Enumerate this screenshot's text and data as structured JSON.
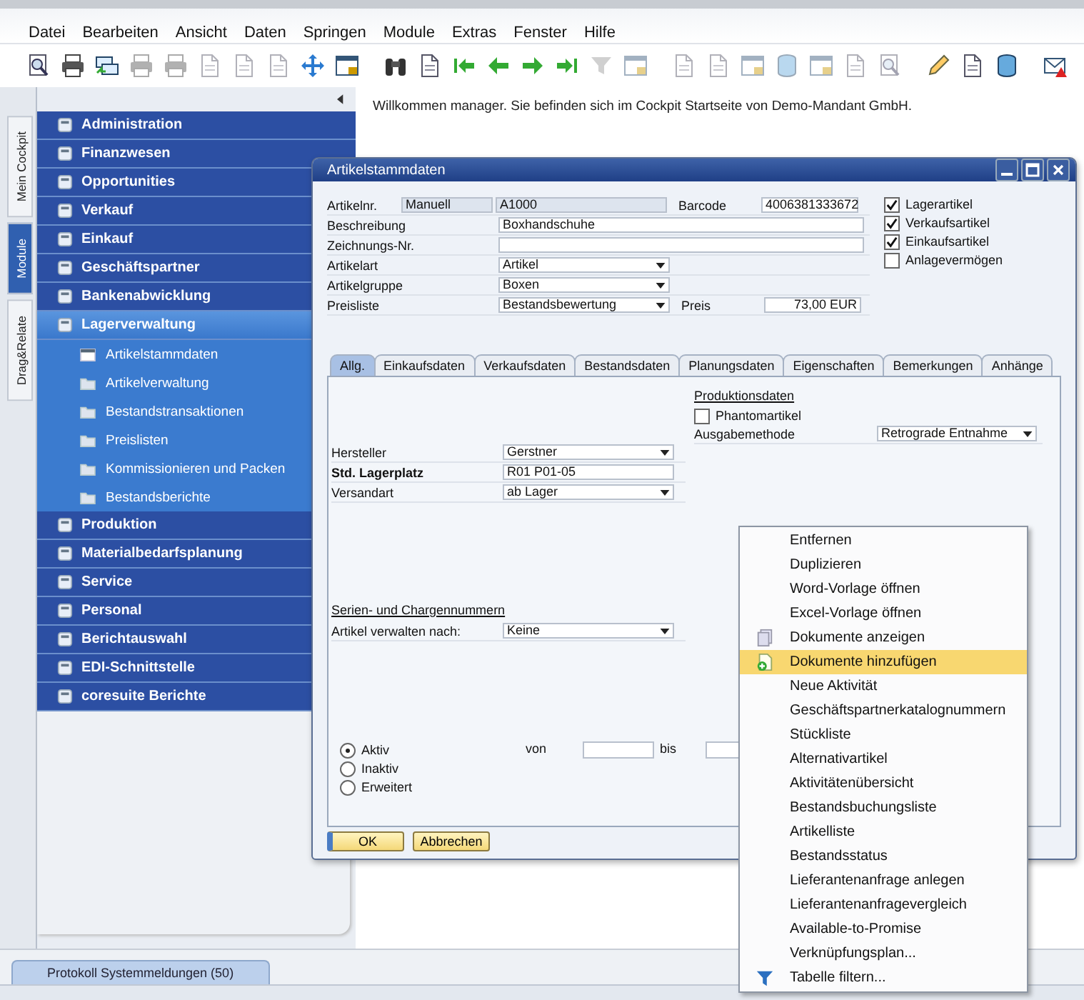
{
  "menu_bar": [
    "Datei",
    "Bearbeiten",
    "Ansicht",
    "Daten",
    "Springen",
    "Module",
    "Extras",
    "Fenster",
    "Hilfe"
  ],
  "side_tabs": [
    {
      "label": "Mein Cockpit",
      "selected": false
    },
    {
      "label": "Module",
      "selected": true
    },
    {
      "label": "Drag&Relate",
      "selected": false
    }
  ],
  "modules": [
    {
      "label": "Administration",
      "selected": false
    },
    {
      "label": "Finanzwesen",
      "selected": false
    },
    {
      "label": "Opportunities",
      "selected": false
    },
    {
      "label": "Verkauf",
      "selected": false
    },
    {
      "label": "Einkauf",
      "selected": false
    },
    {
      "label": "Geschäftspartner",
      "selected": false
    },
    {
      "label": "Bankenabwicklung",
      "selected": false
    },
    {
      "label": "Lagerverwaltung",
      "selected": true,
      "expanded": true,
      "children": [
        {
          "label": "Artikelstammdaten",
          "kind": "window"
        },
        {
          "label": "Artikelverwaltung",
          "kind": "folder"
        },
        {
          "label": "Bestandstransaktionen",
          "kind": "folder"
        },
        {
          "label": "Preislisten",
          "kind": "folder"
        },
        {
          "label": "Kommissionieren und Packen",
          "kind": "folder"
        },
        {
          "label": "Bestandsberichte",
          "kind": "folder"
        }
      ]
    },
    {
      "label": "Produktion",
      "selected": false
    },
    {
      "label": "Materialbedarfsplanung",
      "selected": false
    },
    {
      "label": "Service",
      "selected": false
    },
    {
      "label": "Personal",
      "selected": false
    },
    {
      "label": "Berichtauswahl",
      "selected": false
    },
    {
      "label": "EDI-Schnittstelle",
      "selected": false
    },
    {
      "label": "coresuite Berichte",
      "selected": false
    }
  ],
  "welcome": "Willkommen manager. Sie befinden sich im Cockpit Startseite von Demo-Mandant GmbH.",
  "dialog": {
    "title": "Artikelstammdaten",
    "item_no": {
      "label": "Artikelnr.",
      "mode": "Manuell",
      "value": "A1000"
    },
    "barcode": {
      "label": "Barcode",
      "value": "4006381333672"
    },
    "rows": [
      {
        "label": "Beschreibung",
        "value": "Boxhandschuhe",
        "kind": "text"
      },
      {
        "label": "Zeichnungs-Nr.",
        "kind": "text"
      },
      {
        "label": "Artikelart",
        "value": "Artikel",
        "kind": "dropdown"
      },
      {
        "label": "Artikelgruppe",
        "value": "Boxen",
        "kind": "dropdown"
      },
      {
        "label": "Preisliste",
        "value": "Bestandsbewertung",
        "kind": "dropdown",
        "price": {
          "label": "Preis",
          "value": "73,00 EUR"
        }
      }
    ],
    "flags": [
      {
        "label": "Lagerartikel",
        "checked": true
      },
      {
        "label": "Verkaufsartikel",
        "checked": true
      },
      {
        "label": "Einkaufsartikel",
        "checked": true
      },
      {
        "label": "Anlagevermögen",
        "checked": false
      }
    ],
    "tabs": [
      {
        "label": "Allg.",
        "selected": true
      },
      {
        "label": "Einkaufsdaten",
        "selected": false
      },
      {
        "label": "Verkaufsdaten",
        "selected": false
      },
      {
        "label": "Bestandsdaten",
        "selected": false
      },
      {
        "label": "Planungsdaten",
        "selected": false
      },
      {
        "label": "Eigenschaften",
        "selected": false
      },
      {
        "label": "Bemerkungen",
        "selected": false
      },
      {
        "label": "Anhänge",
        "selected": false
      }
    ],
    "general": {
      "fields": [
        {
          "label": "Hersteller",
          "value": "Gerstner",
          "kind": "dropdown",
          "bold": false
        },
        {
          "label": "Std. Lagerplatz",
          "value": "R01 P01-05",
          "kind": "text",
          "bold": true
        },
        {
          "label": "Versandart",
          "value": "ab Lager",
          "kind": "dropdown",
          "bold": false
        }
      ],
      "production": {
        "heading": "Produktionsdaten",
        "phantom": {
          "label": "Phantomartikel",
          "checked": false
        },
        "method": {
          "label": "Ausgabemethode",
          "value": "Retrograde Entnahme"
        }
      },
      "serials": {
        "heading": "Serien- und Chargennummern",
        "label": "Artikel verwalten nach:",
        "value": "Keine"
      },
      "status": [
        {
          "label": "Aktiv",
          "selected": true
        },
        {
          "label": "Inaktiv",
          "selected": false
        },
        {
          "label": "Erweitert",
          "selected": false
        }
      ],
      "from_label": "von",
      "to_label": "bis"
    },
    "buttons": [
      {
        "label": "OK",
        "kind": "primary"
      },
      {
        "label": "Abbrechen",
        "kind": "secondary"
      }
    ]
  },
  "context_menu": [
    {
      "label": "Entfernen",
      "kind": "plain",
      "selected": false
    },
    {
      "label": "Duplizieren",
      "kind": "plain",
      "selected": false
    },
    {
      "label": "Word-Vorlage öffnen",
      "kind": "plain",
      "selected": false
    },
    {
      "label": "Excel-Vorlage öffnen",
      "kind": "plain",
      "selected": false
    },
    {
      "label": "Dokumente anzeigen",
      "kind": "documents",
      "selected": false
    },
    {
      "label": "Dokumente hinzufügen",
      "kind": "add-document",
      "selected": true
    },
    {
      "label": "Neue Aktivität",
      "kind": "plain",
      "selected": false
    },
    {
      "label": "Geschäftspartnerkatalognummern",
      "kind": "plain",
      "selected": false
    },
    {
      "label": "Stückliste",
      "kind": "plain",
      "selected": false
    },
    {
      "label": "Alternativartikel",
      "kind": "plain",
      "selected": false
    },
    {
      "label": "Aktivitätenübersicht",
      "kind": "plain",
      "selected": false
    },
    {
      "label": "Bestandsbuchungsliste",
      "kind": "plain",
      "selected": false
    },
    {
      "label": "Artikelliste",
      "kind": "plain",
      "selected": false
    },
    {
      "label": "Bestandsstatus",
      "kind": "plain",
      "selected": false
    },
    {
      "label": "Lieferantenanfrage anlegen",
      "kind": "plain",
      "selected": false
    },
    {
      "label": "Lieferantenanfragevergleich",
      "kind": "plain",
      "selected": false
    },
    {
      "label": "Available-to-Promise",
      "kind": "plain",
      "selected": false
    },
    {
      "label": "Verknüpfungsplan...",
      "kind": "plain",
      "selected": false
    },
    {
      "label": "Tabelle filtern...",
      "kind": "filter",
      "selected": false
    }
  ],
  "bottom_tab": "Protokoll Systemmeldungen (50)"
}
